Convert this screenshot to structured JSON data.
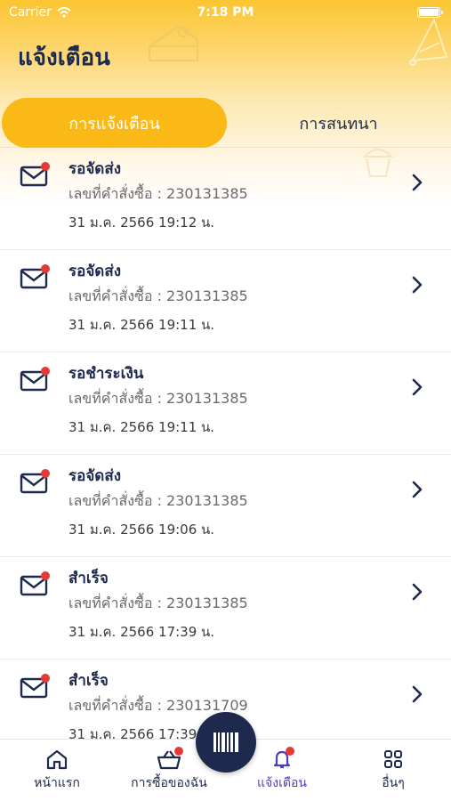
{
  "status_bar": {
    "carrier": "Carrier",
    "time": "7:18 PM"
  },
  "header": {
    "title": "แจ้งเตือน"
  },
  "tabs": [
    {
      "label": "การแจ้งเตือน",
      "active": true
    },
    {
      "label": "การสนทนา",
      "active": false
    }
  ],
  "notifications": [
    {
      "status": "รอจัดส่ง",
      "order": "เลขที่คำสั่งซื้อ : 230131385",
      "date": "31 ม.ค. 2566 19:12 น.",
      "unread": true
    },
    {
      "status": "รอจัดส่ง",
      "order": "เลขที่คำสั่งซื้อ : 230131385",
      "date": "31 ม.ค. 2566 19:11 น.",
      "unread": true
    },
    {
      "status": "รอชำระเงิน",
      "order": "เลขที่คำสั่งซื้อ : 230131385",
      "date": "31 ม.ค. 2566 19:11 น.",
      "unread": true
    },
    {
      "status": "รอจัดส่ง",
      "order": "เลขที่คำสั่งซื้อ : 230131385",
      "date": "31 ม.ค. 2566 19:06 น.",
      "unread": true
    },
    {
      "status": "สำเร็จ",
      "order": "เลขที่คำสั่งซื้อ : 230131385",
      "date": "31 ม.ค. 2566 17:39 น.",
      "unread": true
    },
    {
      "status": "สำเร็จ",
      "order": "เลขที่คำสั่งซื้อ : 230131709",
      "date": "31 ม.ค. 2566 17:39 น.",
      "unread": true
    }
  ],
  "tabbar": {
    "home": "หน้าแรก",
    "purchases": "การซื้อของฉัน",
    "notifications": "แจ้งเตือน",
    "more": "อื่นๆ"
  },
  "icons": {
    "row_icon": "envelope-icon",
    "row_arrow": "chevron-right-icon",
    "scan": "barcode-icon"
  },
  "colors": {
    "accent": "#fbb917",
    "navy": "#1d2a4d",
    "badge": "#e53935",
    "active_tab": "#4a3fbf"
  }
}
